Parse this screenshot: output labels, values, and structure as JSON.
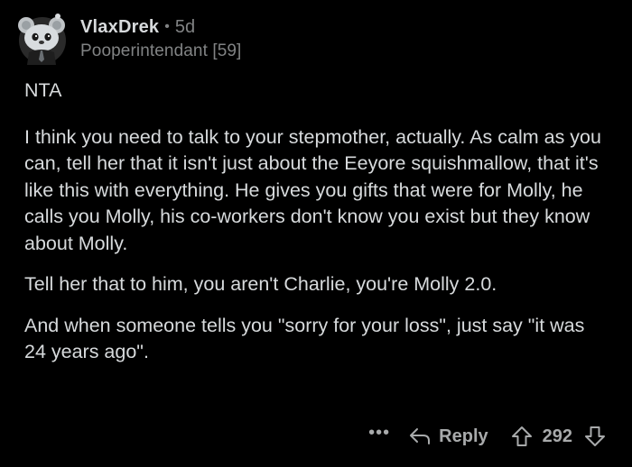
{
  "comment": {
    "author": "VlaxDrek",
    "separator": "•",
    "age": "5d",
    "flair": "Pooperintendant [59]",
    "paragraphs": [
      "NTA",
      "I think you need to talk to your stepmother, actually.  As calm as you can, tell her that it isn't just about the Eeyore squishmallow, that it's like this with everything. He gives you gifts that were for Molly, he calls you Molly, his co-workers don't know you exist but they know about Molly.",
      "Tell her that to him, you aren't Charlie, you're Molly 2.0.",
      "And when someone tells you \"sorry for your loss\", just say \"it was 24 years ago\"."
    ]
  },
  "actions": {
    "more_label": "•••",
    "reply_label": "Reply",
    "score": "292",
    "icons": {
      "more": "more-options-icon",
      "reply": "reply-arrow-icon",
      "upvote": "upvote-arrow-icon",
      "downvote": "downvote-arrow-icon",
      "avatar": "snoo-avatar-icon"
    }
  },
  "colors": {
    "background": "#000000",
    "text": "#d7dadc",
    "muted": "#818384",
    "action": "#a8aaab"
  }
}
